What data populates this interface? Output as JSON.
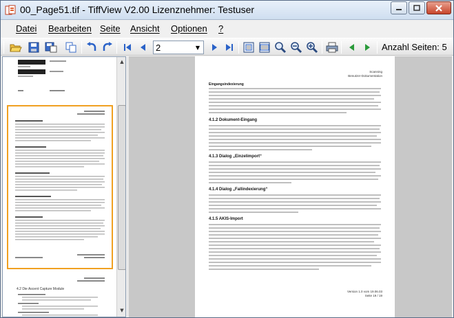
{
  "window": {
    "title": "00_Page51.tif - TiffView V2.00   Lizenznehmer: Testuser"
  },
  "menu": {
    "items": [
      "Datei",
      "Bearbeiten",
      "Seite",
      "Ansicht",
      "Optionen",
      "?"
    ]
  },
  "toolbar": {
    "page_value": "2",
    "page_count_label": "Anzahl Seiten: 5",
    "icons": [
      "open-icon",
      "save-icon",
      "save-as-icon",
      "copy-icon",
      "rotate-left-icon",
      "rotate-right-icon",
      "first-page-icon",
      "previous-page-icon",
      "next-page-icon",
      "last-page-icon",
      "fit-page-icon",
      "fit-width-icon",
      "zoom-in-icon",
      "zoom-out-icon",
      "zoom-fit-icon",
      "print-icon",
      "back-icon",
      "forward-icon"
    ]
  },
  "thumbnails": {
    "count_visible": 3,
    "selected_index": 1,
    "thumb3_heading": "4.2  Die Ascent Capture Module"
  },
  "document": {
    "header_right": [
      "Scanning",
      "Benutzer-Dokumentation"
    ],
    "intro_heading": "Eingangsindexierung",
    "sections": [
      "4.1.2  Dokument-Eingang",
      "4.1.3  Dialog „Einzelimport“",
      "4.1.4  Dialog „Fallindexierung“",
      "4.1.5  AKIS-Import"
    ],
    "footer": [
      "Version 1.0 vom 19.06.03",
      "Seite 19 / 19"
    ]
  },
  "colors": {
    "accent_selection": "#f0a020",
    "viewer_bg": "#c8c8c8",
    "titlebar": "#cfdef0"
  }
}
